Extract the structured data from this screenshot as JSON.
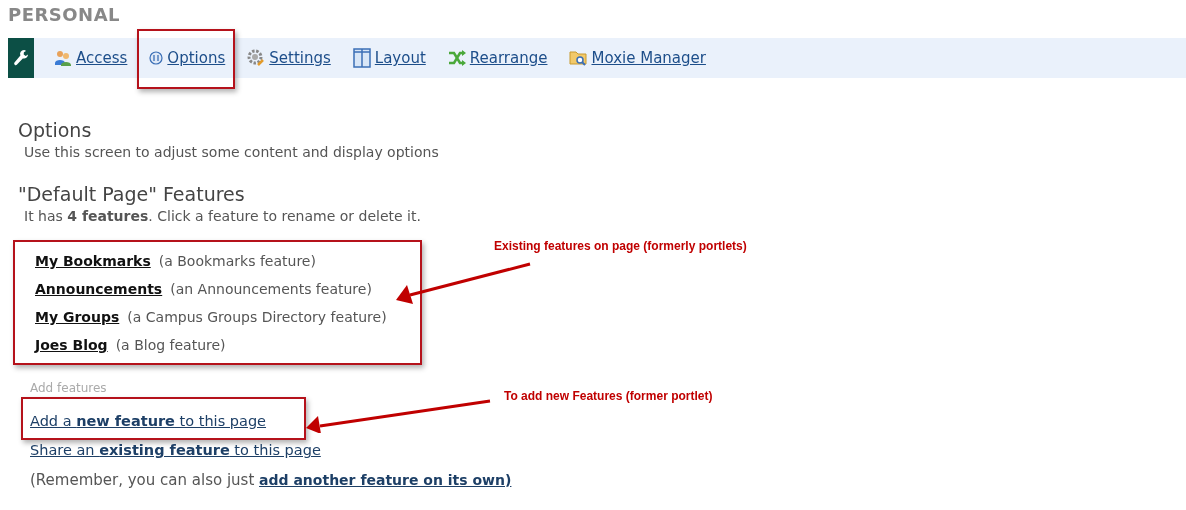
{
  "section_title": "PERSONAL",
  "toolbar": {
    "tabs": [
      {
        "label": "Access",
        "highlighted": false
      },
      {
        "label": "Options",
        "highlighted": true
      },
      {
        "label": "Settings",
        "highlighted": false
      },
      {
        "label": "Layout",
        "highlighted": false
      },
      {
        "label": "Rearrange",
        "highlighted": false
      },
      {
        "label": "Moxie Manager",
        "highlighted": false
      }
    ]
  },
  "options": {
    "title": "Options",
    "description": "Use this screen to adjust some content and display options"
  },
  "features": {
    "title": "\"Default Page\" Features",
    "summary": "It has **4 features**. Click a feature to rename or delete it.",
    "highlighted": true,
    "items": [
      {
        "name": "My Bookmarks",
        "description": "(a Bookmarks feature)"
      },
      {
        "name": "Announcements",
        "description": "(an Announcements feature)"
      },
      {
        "name": "My Groups",
        "description": "(a Campus Groups Directory feature)"
      },
      {
        "name": "Joes Blog",
        "description": "(a Blog feature)"
      }
    ]
  },
  "add_features": {
    "label": "Add features",
    "links": [
      {
        "text": "Add a **new feature** to this page",
        "highlighted": true
      },
      {
        "text": "Share an **existing feature** to this page",
        "highlighted": false
      }
    ],
    "note_prefix": "(Remember, you can also just ",
    "note_link": "add another feature on its own)"
  },
  "annotations": [
    {
      "text": "Existing features on page (formerly portlets)"
    },
    {
      "text": "To add new Features (former portlet)"
    }
  ]
}
